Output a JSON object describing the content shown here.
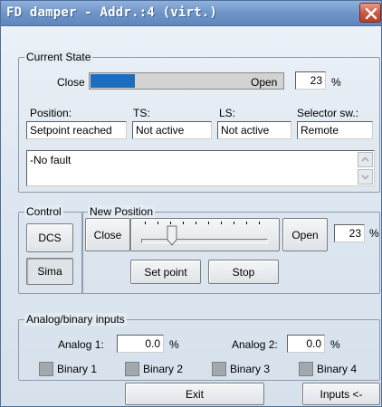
{
  "window": {
    "title": "FD damper - Addr.:4 (virt.)"
  },
  "current_state": {
    "group_label": "Current State",
    "close_label": "Close",
    "open_label": "Open",
    "position_percent": 23,
    "position_value": "23",
    "unit": "%",
    "columns": [
      {
        "label": "Position:",
        "value": "Setpoint reached"
      },
      {
        "label": "TS:",
        "value": "Not active"
      },
      {
        "label": "LS:",
        "value": "Not active"
      },
      {
        "label": "Selector sw.:",
        "value": "Remote"
      }
    ],
    "fault_text": "-No fault"
  },
  "control": {
    "group_label": "Control",
    "dcs_label": "DCS",
    "sima_label": "Sima"
  },
  "new_position": {
    "group_label": "New Position",
    "close_label": "Close",
    "open_label": "Open",
    "value": "23",
    "unit": "%",
    "slider_percent": 23,
    "set_point_label": "Set point",
    "stop_label": "Stop"
  },
  "analog_binary": {
    "group_label": "Analog/binary inputs",
    "analog1_label": "Analog 1:",
    "analog1_value": "0.0",
    "analog2_label": "Analog 2:",
    "analog2_value": "0.0",
    "unit": "%",
    "binary_labels": [
      "Binary 1",
      "Binary 2",
      "Binary 3",
      "Binary 4"
    ]
  },
  "footer": {
    "exit_label": "Exit",
    "inputs_label": "Inputs <-"
  },
  "colors": {
    "progress_fill": "#1e6cbd",
    "titlebar": "#6f94c6",
    "close_button": "#c9573f"
  }
}
